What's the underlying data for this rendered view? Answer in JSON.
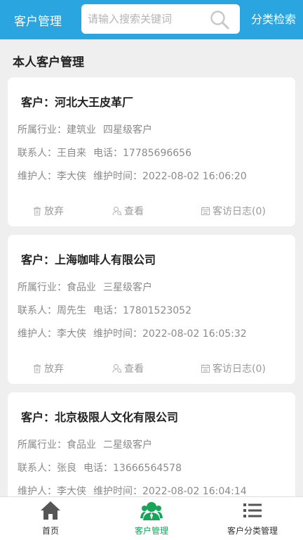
{
  "header": {
    "title": "客户管理",
    "search_placeholder": "请输入搜索关键词",
    "category_search": "分类检索"
  },
  "section_title": "本人客户管理",
  "customers": [
    {
      "name": "客户：河北大王皮革厂",
      "industry": "所属行业：建筑业",
      "level": "四星级客户",
      "contact": "联系人：王自来",
      "phone": "电话：17785696656",
      "maintainer": "维护人：李大侠",
      "maintain_time": "维护时间：2022-08-02 16:06:20"
    },
    {
      "name": "客户：上海咖啡人有限公司",
      "industry": "所属行业：食品业",
      "level": "三星级客户",
      "contact": "联系人：周先生",
      "phone": "电话：17801523052",
      "maintainer": "维护人：李大侠",
      "maintain_time": "维护时间：2022-08-02 16:05:32"
    },
    {
      "name": "客户：北京极限人文化有限公司",
      "industry": "所属行业：食品业",
      "level": "二星级客户",
      "contact": "联系人：张良",
      "phone": "电话：13666564578",
      "maintainer": "维护人：李大侠",
      "maintain_time": "维护时间：2022-08-02 16:04:14"
    }
  ],
  "actions": {
    "abandon": "放弃",
    "view": "查看",
    "visit_log": "客访日志(0)"
  },
  "tabbar": {
    "home": "首页",
    "customer_mgmt": "客户管理",
    "category_mgmt": "客户分类管理"
  },
  "colors": {
    "header_bg": "#2aa5e0",
    "active_tab": "#17a55a",
    "icon_gray": "#555555"
  }
}
